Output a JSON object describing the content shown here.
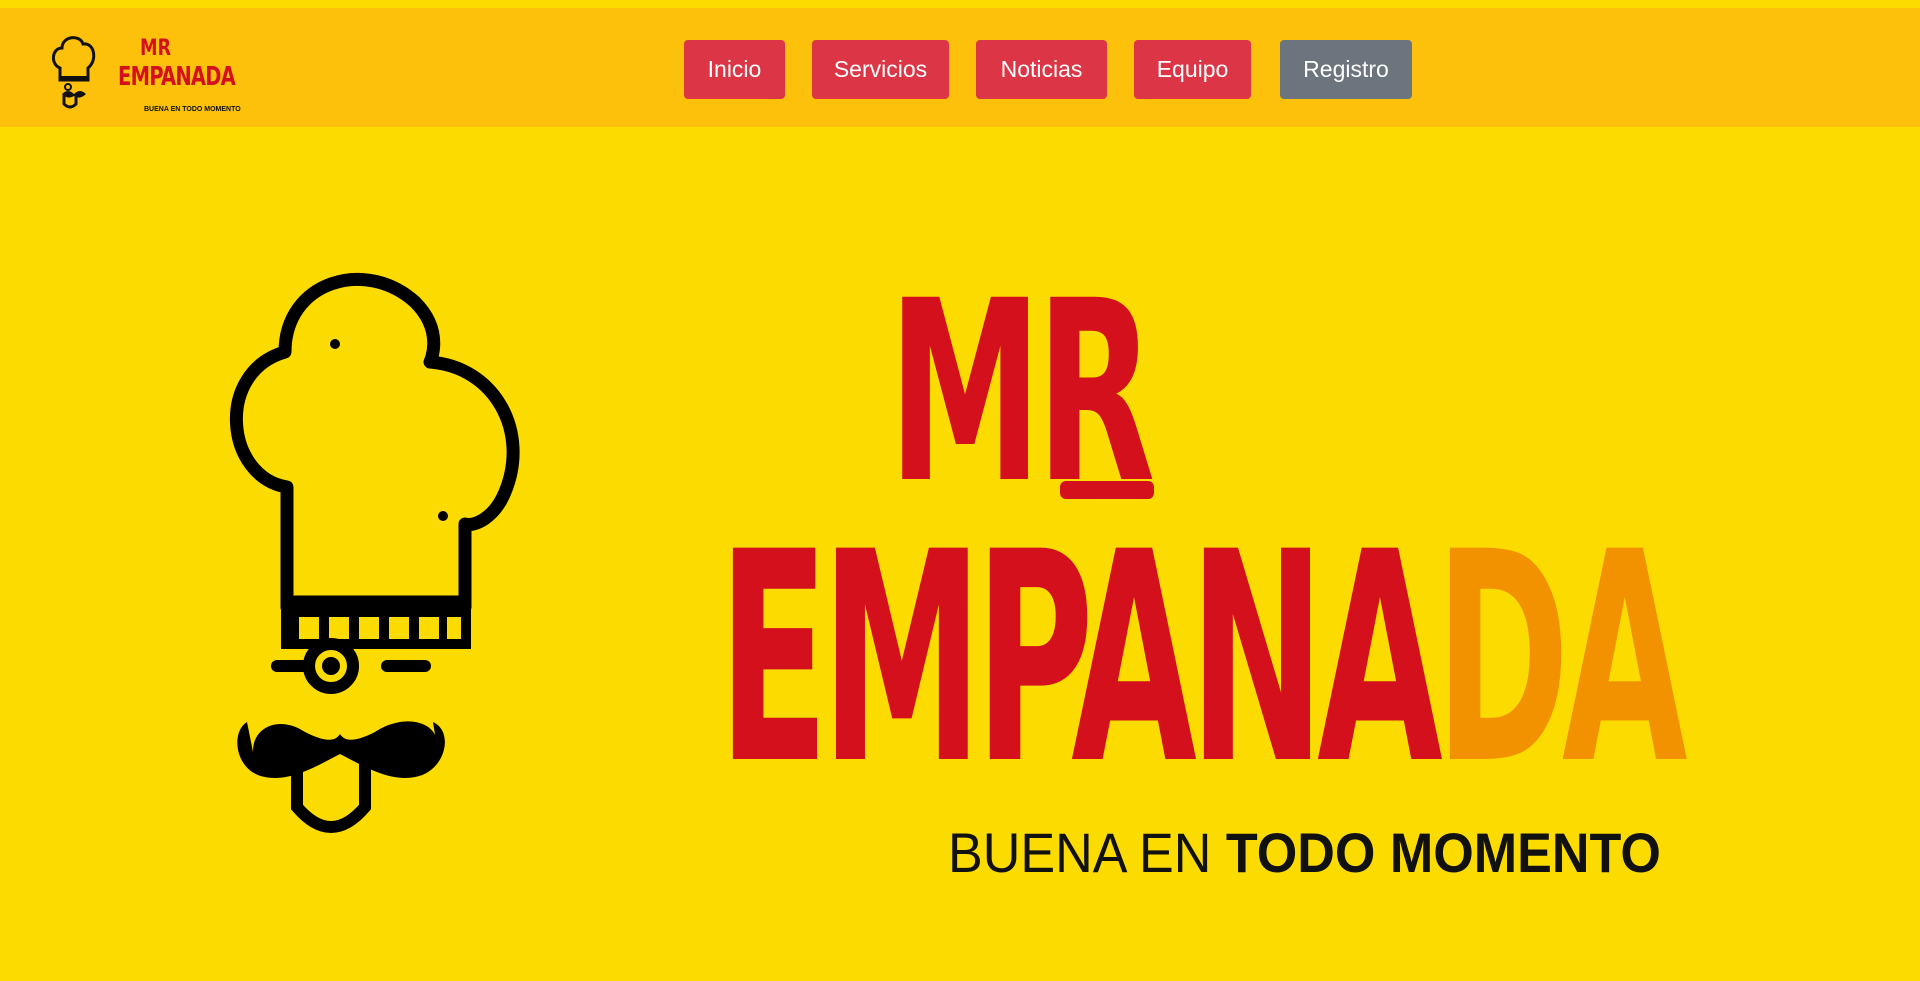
{
  "navbar": {
    "logo": {
      "line1": "MR",
      "line2": "EMPANADA",
      "tagline": "BUENA EN TODO MOMENTO"
    },
    "items": [
      {
        "label": "Inicio",
        "color": "#dc3545"
      },
      {
        "label": "Servicios",
        "color": "#dc3545"
      },
      {
        "label": "Noticias",
        "color": "#dc3545"
      },
      {
        "label": "Equipo",
        "color": "#dc3545"
      },
      {
        "label": "Registro",
        "color": "#6c757d"
      }
    ]
  },
  "hero": {
    "title_line1": "MR",
    "title_line2_main": "EMPANA",
    "title_line2_accent": "DA",
    "tagline_regular": "BUENA EN",
    "tagline_bold": "TODO MOMENTO",
    "colors": {
      "background": "#fcdc00",
      "red": "#d4101d",
      "orange": "#f39200"
    }
  }
}
